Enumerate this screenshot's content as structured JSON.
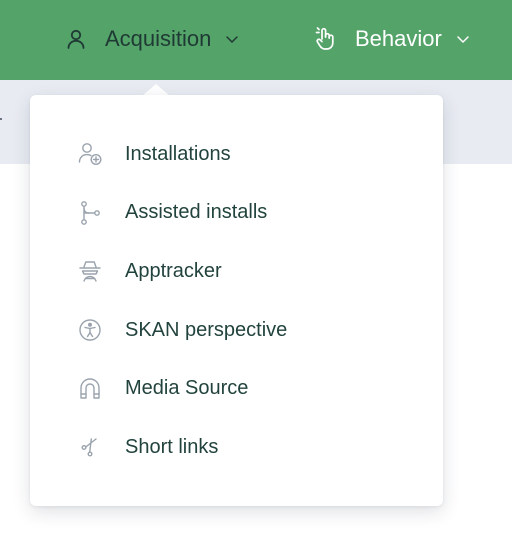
{
  "nav": {
    "acquisition": {
      "label": "Acquisition",
      "icon": "user-icon"
    },
    "behavior": {
      "label": "Behavior",
      "icon": "pointer-hand-icon"
    }
  },
  "dropdown": {
    "items": [
      {
        "label": "Installations",
        "icon": "user-plus-icon"
      },
      {
        "label": "Assisted installs",
        "icon": "branch-icon"
      },
      {
        "label": "Apptracker",
        "icon": "spy-icon"
      },
      {
        "label": "SKAN perspective",
        "icon": "accessibility-icon"
      },
      {
        "label": "Media Source",
        "icon": "magnet-icon"
      },
      {
        "label": "Short links",
        "icon": "scissors-icon"
      }
    ]
  },
  "colors": {
    "topbar": "#54a369",
    "subbar": "#e8ebf2",
    "text": "#22433d",
    "icon": "#9aa3ad"
  }
}
